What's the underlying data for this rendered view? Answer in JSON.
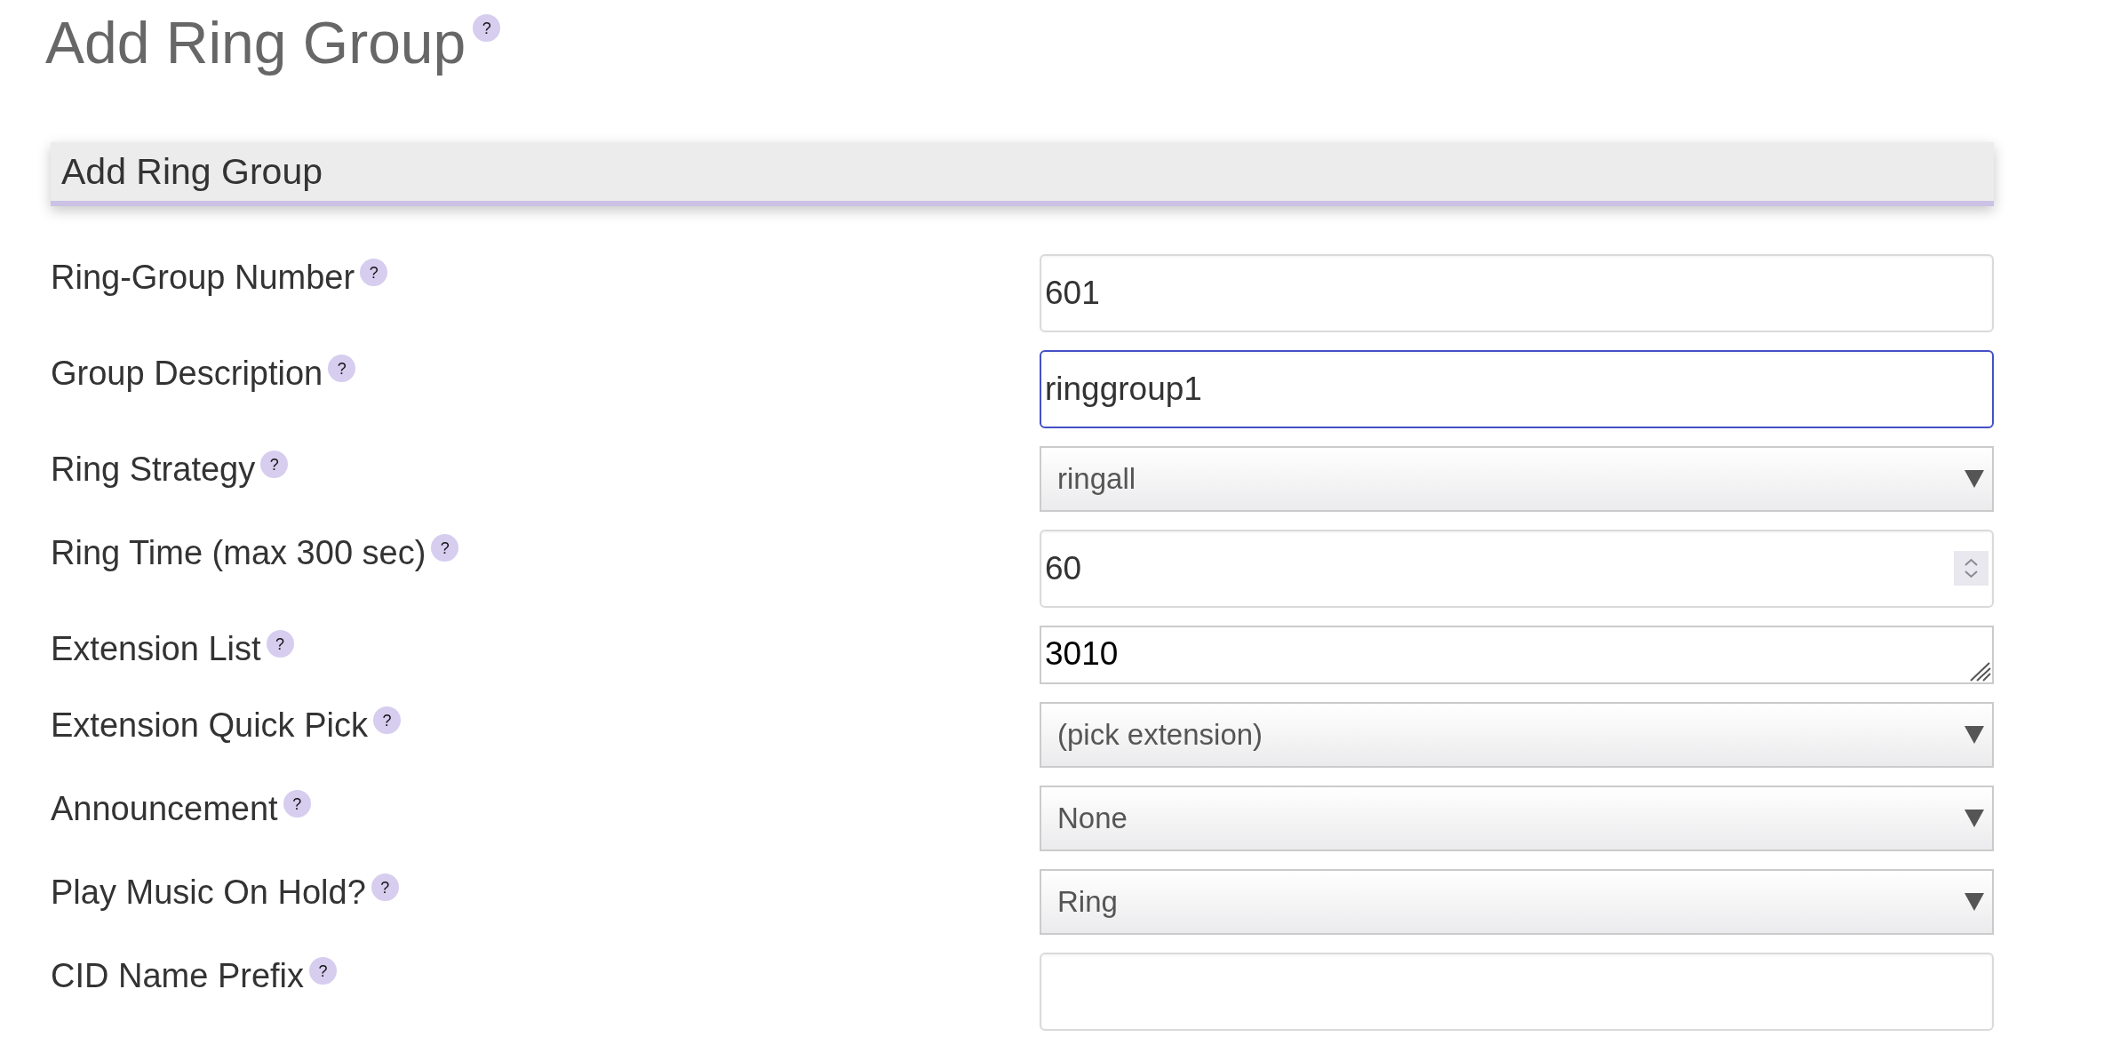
{
  "page": {
    "title": "Add Ring Group",
    "help": "?"
  },
  "section": {
    "title": "Add Ring Group"
  },
  "fields": [
    {
      "label": "Ring-Group Number",
      "help": "?",
      "kind": "text",
      "value": "601",
      "focused": false
    },
    {
      "label": "Group Description",
      "help": "?",
      "kind": "text",
      "value": "ringgroup1",
      "focused": true
    },
    {
      "label": "Ring Strategy",
      "help": "?",
      "kind": "select",
      "value": "ringall",
      "focused": false
    },
    {
      "label": "Ring Time (max 300 sec)",
      "help": "?",
      "kind": "number",
      "value": "60",
      "focused": false
    },
    {
      "label": "Extension List",
      "help": "?",
      "kind": "textarea",
      "value": "3010",
      "focused": false
    },
    {
      "label": "Extension Quick Pick",
      "help": "?",
      "kind": "select",
      "value": "(pick extension)",
      "focused": false
    },
    {
      "label": "Announcement",
      "help": "?",
      "kind": "select",
      "value": "None",
      "focused": false
    },
    {
      "label": "Play Music On Hold?",
      "help": "?",
      "kind": "select",
      "value": "Ring",
      "focused": false
    },
    {
      "label": "CID Name Prefix",
      "help": "?",
      "kind": "text",
      "focused": false
    }
  ]
}
